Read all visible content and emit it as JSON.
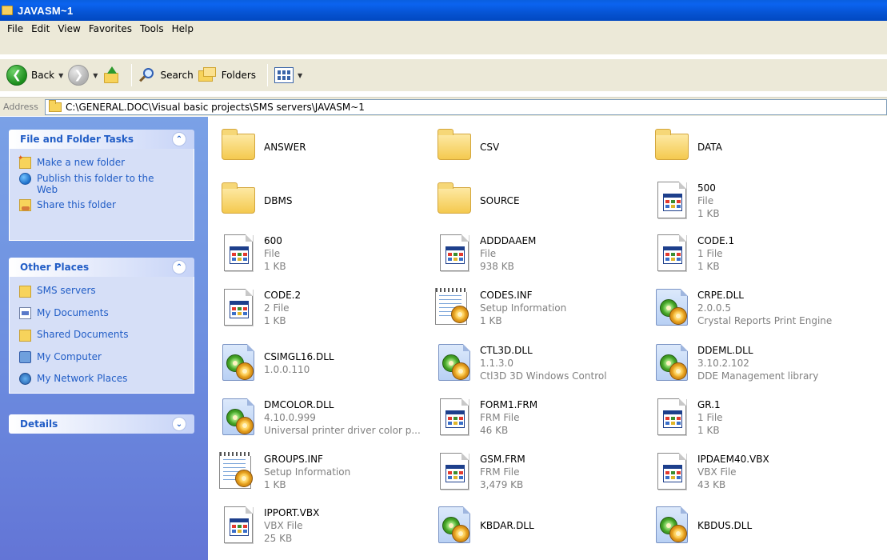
{
  "window": {
    "title": "JAVASM~1"
  },
  "menu": [
    "File",
    "Edit",
    "View",
    "Favorites",
    "Tools",
    "Help"
  ],
  "toolbar": {
    "back": "Back",
    "search": "Search",
    "folders": "Folders"
  },
  "address": {
    "label": "Address",
    "path": "C:\\GENERAL.DOC\\Visual basic projects\\SMS servers\\JAVASM~1"
  },
  "tasks_panel": {
    "title": "File and Folder Tasks",
    "items": [
      "Make a new folder",
      "Publish this folder to the Web",
      "Share this folder"
    ]
  },
  "places_panel": {
    "title": "Other Places",
    "items": [
      "SMS servers",
      "My Documents",
      "Shared Documents",
      "My Computer",
      "My Network Places"
    ]
  },
  "details_panel": {
    "title": "Details"
  },
  "files": [
    {
      "name": "ANSWER",
      "type": "folder",
      "line2": "",
      "line3": ""
    },
    {
      "name": "CSV",
      "type": "folder",
      "line2": "",
      "line3": ""
    },
    {
      "name": "DATA",
      "type": "folder",
      "line2": "",
      "line3": ""
    },
    {
      "name": "DBMS",
      "type": "folder",
      "line2": "",
      "line3": ""
    },
    {
      "name": "SOURCE",
      "type": "folder",
      "line2": "",
      "line3": ""
    },
    {
      "name": "500",
      "type": "file",
      "line2": "File",
      "line3": "1 KB"
    },
    {
      "name": "600",
      "type": "file",
      "line2": "File",
      "line3": "1 KB"
    },
    {
      "name": "ADDDAAEM",
      "type": "file",
      "line2": "File",
      "line3": "938 KB"
    },
    {
      "name": "CODE.1",
      "type": "file",
      "line2": "1 File",
      "line3": "1 KB"
    },
    {
      "name": "CODE.2",
      "type": "file",
      "line2": "2 File",
      "line3": "1 KB"
    },
    {
      "name": "CODES.INF",
      "type": "inf",
      "line2": "Setup Information",
      "line3": "1 KB"
    },
    {
      "name": "CRPE.DLL",
      "type": "dll",
      "line2": "2.0.0.5",
      "line3": "Crystal Reports Print Engine"
    },
    {
      "name": "CSIMGL16.DLL",
      "type": "dll",
      "line2": "1.0.0.110",
      "line3": ""
    },
    {
      "name": "CTL3D.DLL",
      "type": "dll",
      "line2": "1.1.3.0",
      "line3": "Ctl3D 3D Windows Control"
    },
    {
      "name": "DDEML.DLL",
      "type": "dll",
      "line2": "3.10.2.102",
      "line3": "DDE Management library"
    },
    {
      "name": "DMCOLOR.DLL",
      "type": "dll",
      "line2": "4.10.0.999",
      "line3": "Universal printer driver color p..."
    },
    {
      "name": "FORM1.FRM",
      "type": "file",
      "line2": "FRM File",
      "line3": "46 KB"
    },
    {
      "name": "GR.1",
      "type": "file",
      "line2": "1 File",
      "line3": "1 KB"
    },
    {
      "name": "GROUPS.INF",
      "type": "inf",
      "line2": "Setup Information",
      "line3": "1 KB"
    },
    {
      "name": "GSM.FRM",
      "type": "file",
      "line2": "FRM File",
      "line3": "3,479 KB"
    },
    {
      "name": "IPDAEM40.VBX",
      "type": "file",
      "line2": "VBX File",
      "line3": "43 KB"
    },
    {
      "name": "IPPORT.VBX",
      "type": "file",
      "line2": "VBX File",
      "line3": "25 KB"
    },
    {
      "name": "KBDAR.DLL",
      "type": "dll",
      "line2": "",
      "line3": ""
    },
    {
      "name": "KBDUS.DLL",
      "type": "dll",
      "line2": "",
      "line3": ""
    }
  ]
}
